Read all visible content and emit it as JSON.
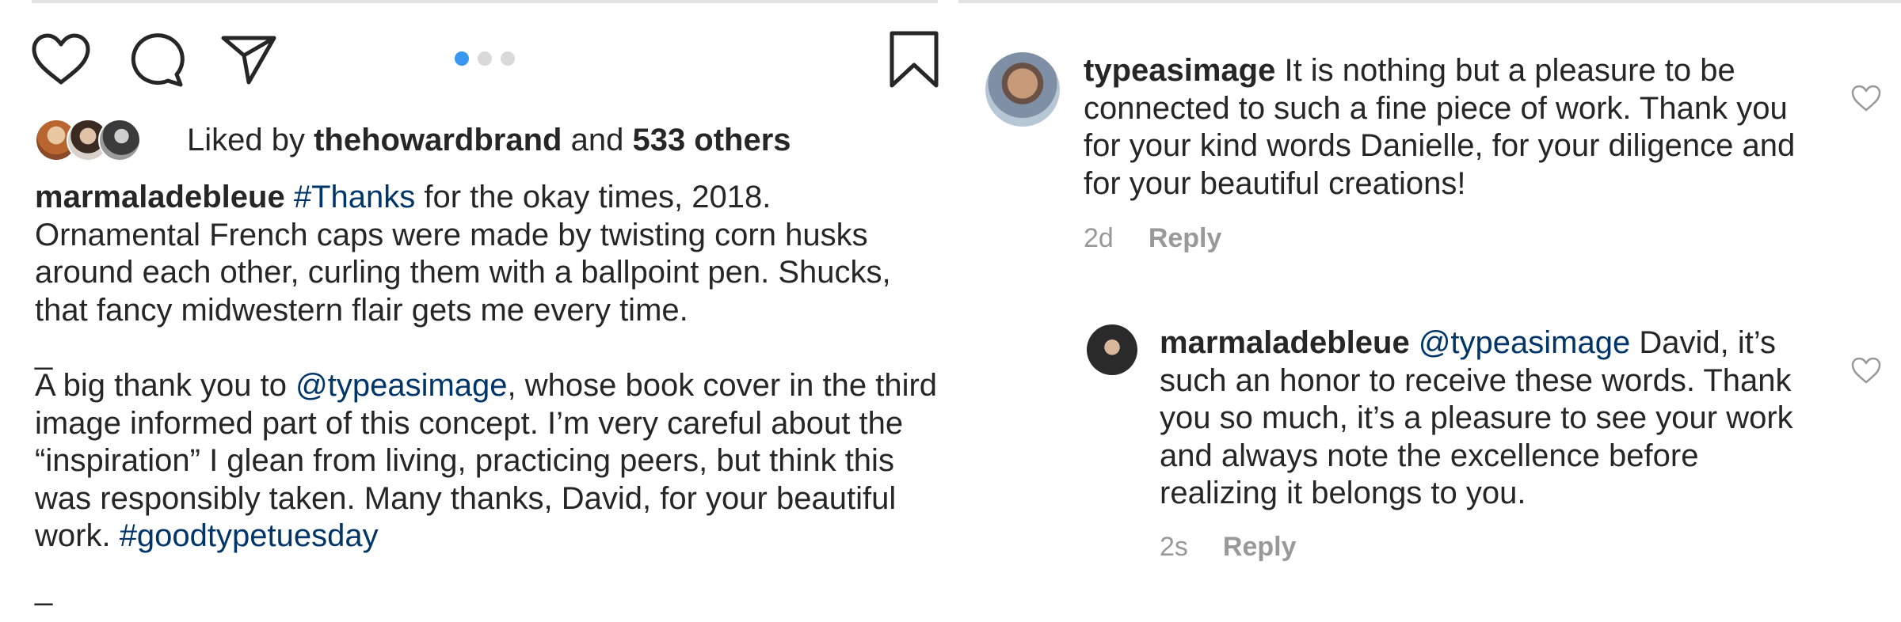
{
  "post": {
    "carousel": {
      "count": 3,
      "active_index": 0
    },
    "likes": {
      "prefix": "Liked by",
      "user": "thehowardbrand",
      "connector": "and",
      "others": "533 others"
    },
    "caption": {
      "username": "marmaladebleue",
      "p1_hashtag": "#Thanks",
      "p1_text": " for the okay times, 2018. Ornamental French caps were made by twisting corn husks around each other, curling them with a ballpoint pen. Shucks, that fancy midwestern flair gets me every time.",
      "divider1": "_",
      "p2_before": "A big thank you to ",
      "p2_mention": "@typeasimage",
      "p2_after": ", whose book cover in the third image informed part of this concept. I’m very careful about the “inspiration” I glean from living, practicing peers, but think this was responsibly taken. Many thanks, David, for your beautiful work. ",
      "p2_hashtag": "#goodtypetuesday",
      "divider2": "_"
    }
  },
  "comments": [
    {
      "username": "typeasimage",
      "text": " It is nothing but a pleasure to be connected to such a fine piece of work. Thank you for your kind words Danielle, for your diligence and for your beautiful creations!",
      "age": "2d",
      "reply_label": "Reply"
    },
    {
      "username": "marmaladebleue",
      "mention": "@typeasimage",
      "text": " David, it’s such an honor to receive these words. Thank you so much, it’s a pleasure to see your work and always note the excellence before realizing it belongs to you.",
      "age": "2s",
      "reply_label": "Reply"
    }
  ],
  "colors": {
    "text": "#262626",
    "link": "#003569",
    "secondary": "#999999",
    "dot_active": "#3897f0",
    "dot_inactive": "#d9d9d9"
  },
  "icons": [
    "heart-icon",
    "comment-icon",
    "share-icon",
    "bookmark-icon",
    "small-heart-icon"
  ]
}
